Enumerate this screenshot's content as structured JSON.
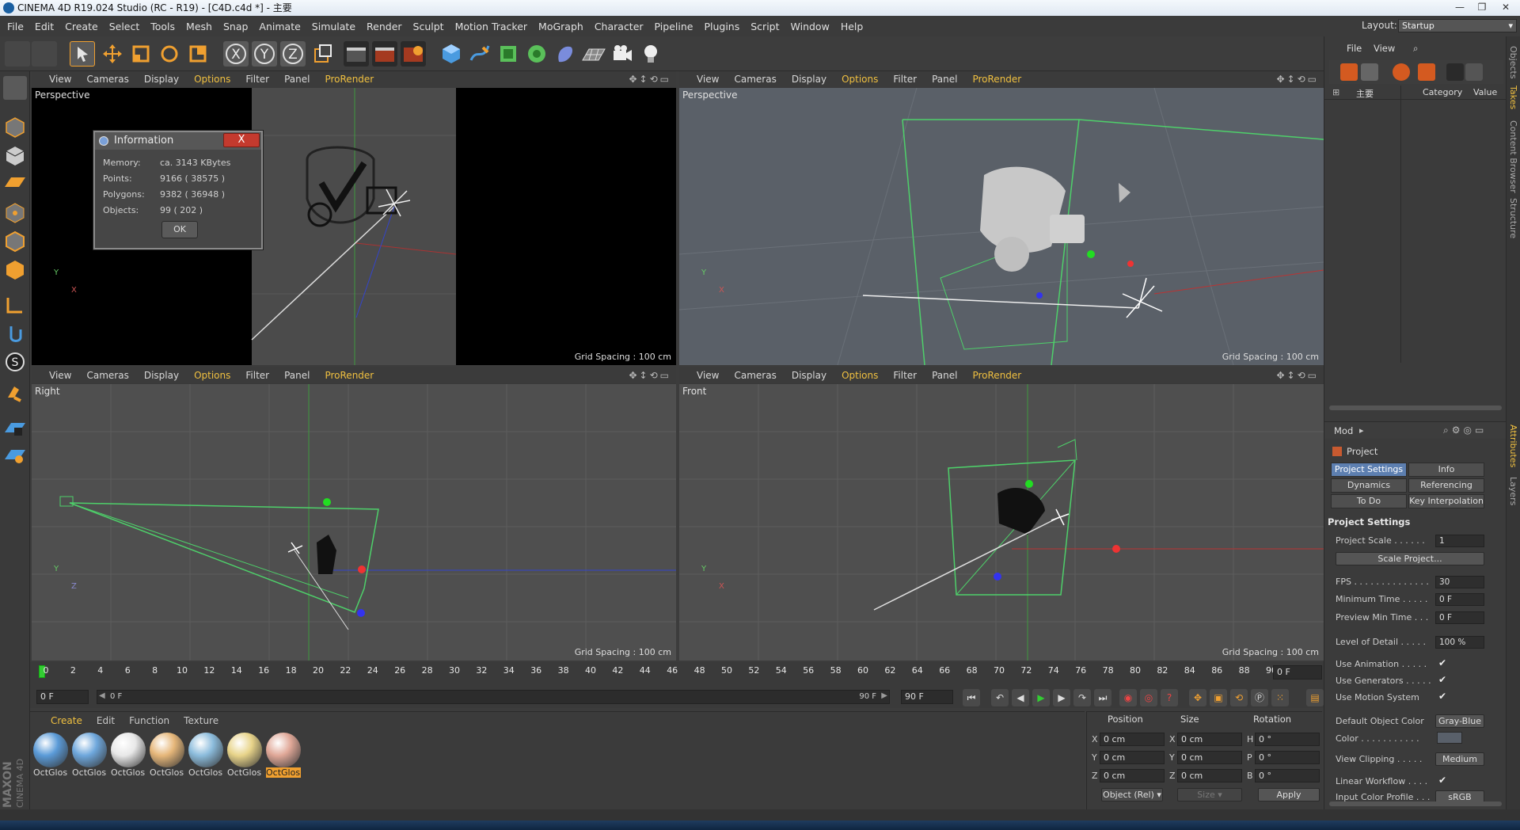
{
  "window": {
    "title": "CINEMA 4D R19.024 Studio (RC - R19) - [C4D.c4d *] - 主要",
    "min": "—",
    "max": "❐",
    "close": "✕"
  },
  "menu": [
    "File",
    "Edit",
    "Create",
    "Select",
    "Tools",
    "Mesh",
    "Snap",
    "Animate",
    "Simulate",
    "Render",
    "Sculpt",
    "Motion Tracker",
    "MoGraph",
    "Character",
    "Pipeline",
    "Plugins",
    "Script",
    "Window",
    "Help"
  ],
  "layout": {
    "label": "Layout:",
    "value": "Startup"
  },
  "viewport_menu": [
    "View",
    "Cameras",
    "Display",
    "Options",
    "Filter",
    "Panel",
    "ProRender"
  ],
  "viewports": [
    {
      "name": "Perspective",
      "grid": "Grid Spacing : 100 cm"
    },
    {
      "name": "Perspective",
      "grid": "Grid Spacing : 100 cm"
    },
    {
      "name": "Right",
      "grid": "Grid Spacing : 100 cm"
    },
    {
      "name": "Front",
      "grid": "Grid Spacing : 100 cm"
    }
  ],
  "axes": {
    "x": "X",
    "y": "Y",
    "z": "Z"
  },
  "info_dialog": {
    "title": "Information",
    "close": "X",
    "rows": [
      {
        "label": "Memory:",
        "value": "ca. 3143 KBytes"
      },
      {
        "label": "Points:",
        "value": "9166 ( 38575 )"
      },
      {
        "label": "Polygons:",
        "value": "9382 ( 36948 )"
      },
      {
        "label": "Objects:",
        "value": "99 ( 202 )"
      }
    ],
    "ok": "OK"
  },
  "timeline": {
    "ticks": [
      "0",
      "2",
      "4",
      "6",
      "8",
      "10",
      "12",
      "14",
      "16",
      "18",
      "20",
      "22",
      "24",
      "26",
      "28",
      "30",
      "32",
      "34",
      "36",
      "38",
      "40",
      "42",
      "44",
      "46",
      "48",
      "50",
      "52",
      "54",
      "56",
      "58",
      "60",
      "62",
      "64",
      "66",
      "68",
      "70",
      "72",
      "74",
      "76",
      "78",
      "80",
      "82",
      "84",
      "86",
      "88",
      "90"
    ],
    "current_frame": "0 F",
    "start": "0 F",
    "range_start": "0 F",
    "range_end": "90 F",
    "end": "90 F"
  },
  "materials": {
    "menu": [
      "Create",
      "Edit",
      "Function",
      "Texture"
    ],
    "items": [
      {
        "label": "OctGlos",
        "color": "#5b9bd8"
      },
      {
        "label": "OctGlos",
        "color": "#6ea7dc"
      },
      {
        "label": "OctGlos",
        "color": "#e8e8e8"
      },
      {
        "label": "OctGlos",
        "color": "#e6b77a"
      },
      {
        "label": "OctGlos",
        "color": "#8cbcdc"
      },
      {
        "label": "OctGlos",
        "color": "#e8d48a"
      },
      {
        "label": "OctGlos",
        "color": "#e0a898"
      }
    ]
  },
  "coordinates": {
    "headers": [
      "Position",
      "Size",
      "Rotation"
    ],
    "rows": [
      {
        "pl": "X",
        "p": "0 cm",
        "sl": "X",
        "s": "0 cm",
        "rl": "H",
        "r": "0 °"
      },
      {
        "pl": "Y",
        "p": "0 cm",
        "sl": "Y",
        "s": "0 cm",
        "rl": "P",
        "r": "0 °"
      },
      {
        "pl": "Z",
        "p": "0 cm",
        "sl": "Z",
        "s": "0 cm",
        "rl": "B",
        "r": "0 °"
      }
    ],
    "mode": "Object (Rel)",
    "size_mode": "Size",
    "apply": "Apply"
  },
  "objects": {
    "menu": [
      "File",
      "View"
    ],
    "root": "主要",
    "columns": [
      "Category",
      "Value"
    ]
  },
  "side_tabs_top": [
    "Objects",
    "Takes",
    "Content Browser",
    "Structure"
  ],
  "side_tabs_bottom": [
    "Attributes",
    "Layers"
  ],
  "attributes": {
    "mode": "Mod",
    "object": "Project",
    "tabs": [
      "Project Settings",
      "Info",
      "Dynamics",
      "Referencing",
      "To Do",
      "Key Interpolation"
    ],
    "section": "Project Settings",
    "project_scale": {
      "label": "Project Scale . . . . . .",
      "value": "1"
    },
    "scale_button": "Scale Project...",
    "fps": {
      "label": "FPS . . . . . . . . . . . . . .",
      "value": "30"
    },
    "min_time": {
      "label": "Minimum Time . . . . .",
      "value": "0 F"
    },
    "preview_min": {
      "label": "Preview Min Time . . .",
      "value": "0 F"
    },
    "lod": {
      "label": "Level of Detail . . . . .",
      "value": "100 %"
    },
    "use_anim": "Use Animation . . . . .",
    "use_gen": "Use Generators . . . . .",
    "use_motion": "Use Motion System",
    "check": "✔",
    "def_color": {
      "label": "Default Object Color",
      "value": "Gray-Blue"
    },
    "color": "Color . . . . . . . . . . .",
    "view_clip": {
      "label": "View Clipping . . . . .",
      "value": "Medium"
    },
    "lin_work": "Linear Workflow . . . .",
    "input_profile": {
      "label": "Input Color Profile . . .",
      "value": "sRGB"
    }
  },
  "brand": {
    "a": "MAXON",
    "b": "CINEMA 4D"
  }
}
